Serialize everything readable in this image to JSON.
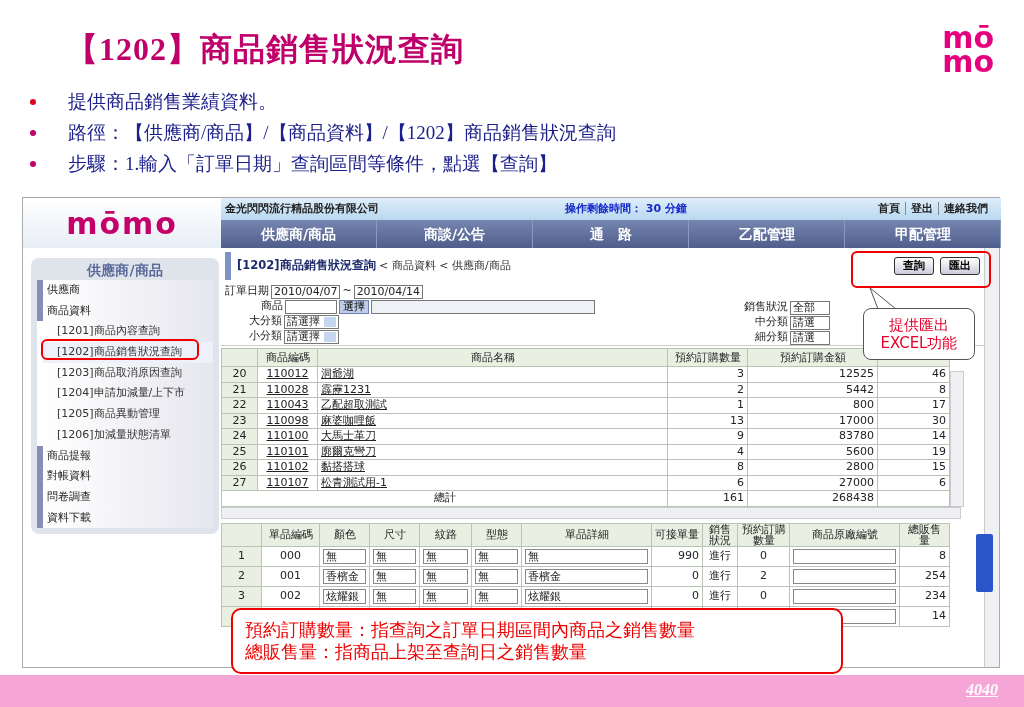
{
  "slide": {
    "title": "【1202】商品銷售狀況查詢",
    "logo": [
      "mō",
      "mo"
    ],
    "bullets": [
      {
        "text": "提供商品銷售業績資料。",
        "color": "#e0001b"
      },
      {
        "text": "路徑：【供應商/商品】/【商品資料】/【1202】商品銷售狀況查詢",
        "color": "#c0006a"
      },
      {
        "text": "步驟：1.輸入「訂單日期」查詢區間等條件，點選【查詢】",
        "color": "#c0006a"
      }
    ],
    "page_number": "4040"
  },
  "app": {
    "logo": "mōmo",
    "company": "金光閃閃流行精品股份有限公司",
    "timer": "操作剩餘時間： 30 分鐘",
    "header_links": [
      "首頁",
      "登出",
      "連絡我們"
    ],
    "nav": [
      "供應商/商品",
      "商談/公告",
      "通　路",
      "乙配管理",
      "甲配管理"
    ],
    "sidebar": {
      "title": "供應商/商品",
      "items": [
        {
          "kind": "section",
          "label": "供應商",
          "selected": false
        },
        {
          "kind": "section",
          "label": "商品資料",
          "selected": false
        },
        {
          "kind": "sub",
          "label": "[1201]商品內容查詢",
          "selected": false
        },
        {
          "kind": "sub",
          "label": "[1202]商品銷售狀況查詢",
          "selected": true
        },
        {
          "kind": "sub",
          "label": "[1203]商品取消原因查詢",
          "selected": false
        },
        {
          "kind": "sub",
          "label": "[1204]申請加減量/上下市",
          "selected": false
        },
        {
          "kind": "sub",
          "label": "[1205]商品異動管理",
          "selected": false
        },
        {
          "kind": "sub",
          "label": "[1206]加減量狀態清單",
          "selected": false
        },
        {
          "kind": "section",
          "label": "商品提報",
          "selected": false
        },
        {
          "kind": "section",
          "label": "對帳資料",
          "selected": false
        },
        {
          "kind": "section",
          "label": "問卷調查",
          "selected": false
        },
        {
          "kind": "section",
          "label": "資料下載",
          "selected": false
        }
      ]
    },
    "page_title": "[1202]商品銷售狀況查詢",
    "breadcrumb": "< 商品資料 < 供應商/商品",
    "buttons": [
      "查詢",
      "匯出"
    ],
    "form": {
      "date_label": "訂單日期",
      "date_from": "2010/04/07",
      "tilde": "~",
      "date_to": "2010/04/14",
      "product_label": "商品",
      "choose_button": "選擇",
      "left_selects": [
        {
          "label": "大分類",
          "value": "請選擇"
        },
        {
          "label": "小分類",
          "value": "請選擇"
        }
      ],
      "right_selects": [
        {
          "label": "銷售狀況",
          "value": "全部"
        },
        {
          "label": "中分類",
          "value": "請選"
        },
        {
          "label": "細分類",
          "value": "請選"
        }
      ]
    },
    "table": {
      "columns": [
        "商品編碼",
        "商品名稱",
        "預約訂購數量",
        "預約訂購金額"
      ],
      "rows": [
        {
          "index": "20",
          "code": "110012",
          "name": "洞爺湖",
          "qty": "3",
          "amount": "12525",
          "column_5": "46"
        },
        {
          "index": "21",
          "code": "110028",
          "name": "霹靂1231",
          "qty": "2",
          "amount": "5442",
          "column_5": "8"
        },
        {
          "index": "22",
          "code": "110043",
          "name": "乙配超取測試",
          "qty": "1",
          "amount": "800",
          "column_5": "17"
        },
        {
          "index": "23",
          "code": "110098",
          "name": "麻婆咖哩飯",
          "qty": "13",
          "amount": "17000",
          "column_5": "30"
        },
        {
          "index": "24",
          "code": "110100",
          "name": "大馬士革刀",
          "qty": "9",
          "amount": "83780",
          "column_5": "14"
        },
        {
          "index": "25",
          "code": "110101",
          "name": "廓爾克彎刀",
          "qty": "4",
          "amount": "5600",
          "column_5": "19"
        },
        {
          "index": "26",
          "code": "110102",
          "name": "黏搭搭球",
          "qty": "8",
          "amount": "2800",
          "column_5": "15"
        },
        {
          "index": "27",
          "code": "110107",
          "name": "松青測試用-1",
          "qty": "6",
          "amount": "27000",
          "column_5": "6"
        }
      ],
      "total": {
        "label": "總計",
        "qty": "161",
        "amount": "268438"
      }
    },
    "items_table": {
      "columns": [
        "單品編碼",
        "顏色",
        "尺寸",
        "紋路",
        "型態",
        "單品詳細",
        "可接單量",
        "銷售狀況",
        "預約訂購數量",
        "商品原廠編號",
        "總販售量"
      ],
      "rows": [
        {
          "index": "1",
          "code": "000",
          "shade": "無",
          "size": "無",
          "pattern": "無",
          "type": "無",
          "detail": "無",
          "available": "990",
          "status": "進行",
          "reserved": "0",
          "total": "8"
        },
        {
          "index": "2",
          "code": "001",
          "shade": "香檳金",
          "size": "無",
          "pattern": "無",
          "type": "無",
          "detail": "香檳金",
          "available": "0",
          "status": "進行",
          "reserved": "2",
          "total": "254"
        },
        {
          "index": "3",
          "code": "002",
          "shade": "炫耀銀",
          "size": "無",
          "pattern": "無",
          "type": "無",
          "detail": "炫耀銀",
          "available": "0",
          "status": "進行",
          "reserved": "0",
          "total": "234"
        },
        {
          "total": "14"
        }
      ]
    },
    "callout": [
      "提供匯出",
      "EXCEL功能"
    ],
    "note": [
      "預約訂購數量：指查詢之訂單日期區間內商品之銷售數量",
      "總販售量：指商品上架至查詢日之銷售數量"
    ]
  }
}
